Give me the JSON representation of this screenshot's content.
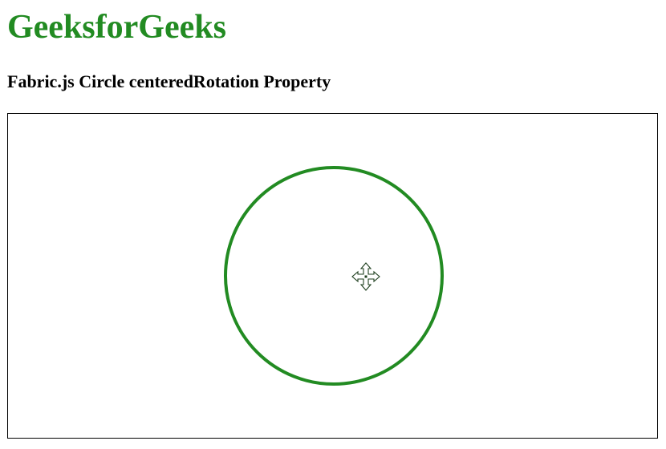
{
  "header": {
    "title": "GeeksforGeeks",
    "title_color": "#228b22",
    "subtitle": "Fabric.js Circle centeredRotation Property"
  },
  "canvas": {
    "border_color": "#000000",
    "circle": {
      "stroke_color": "#228b22",
      "fill": "none"
    },
    "cursor_icon": "move-cursor-icon"
  }
}
